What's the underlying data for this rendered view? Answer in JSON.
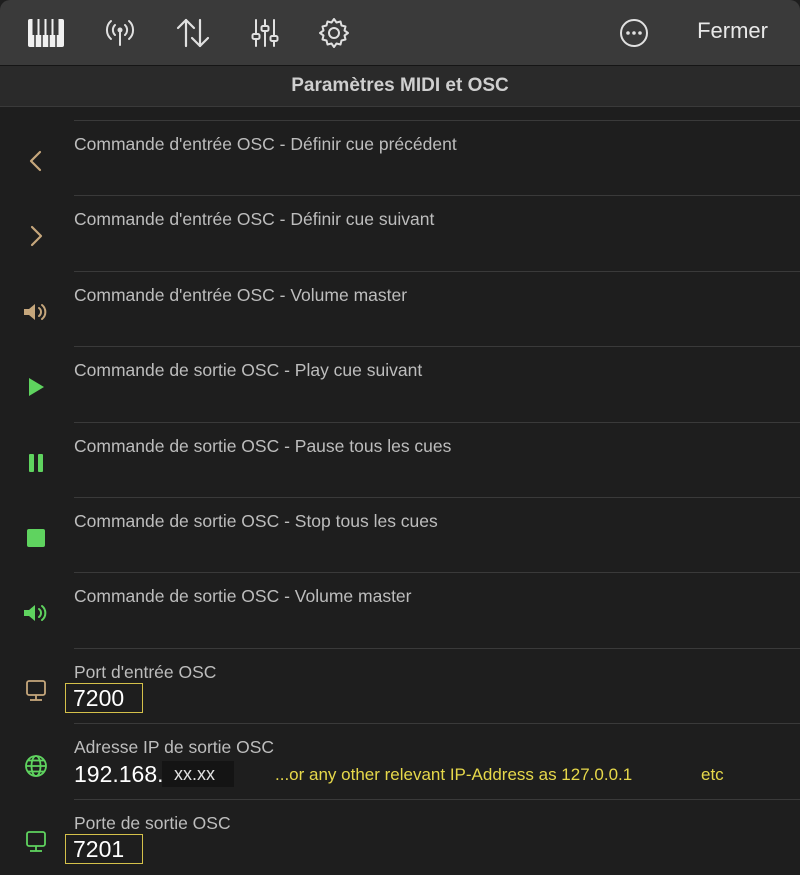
{
  "toolbar": {
    "icons": [
      "piano-keyboard-icon",
      "broadcast-antenna-icon",
      "up-down-arrows-icon",
      "sliders-icon",
      "gear-icon",
      "more-ellipsis-icon"
    ],
    "close_label": "Fermer"
  },
  "title": "Paramètres MIDI et OSC",
  "rows": [
    {
      "label": "Commande d'entrée OSC - Définir cue précédent",
      "icon": "chevron-left-icon"
    },
    {
      "label": "Commande d'entrée OSC - Définir cue suivant",
      "icon": "chevron-right-icon"
    },
    {
      "label": "Commande d'entrée OSC - Volume master",
      "icon": "speaker-icon"
    },
    {
      "label": "Commande de sortie OSC - Play cue suivant",
      "icon": "play-icon"
    },
    {
      "label": "Commande de sortie OSC - Pause tous les cues",
      "icon": "pause-icon"
    },
    {
      "label": "Commande de sortie OSC - Stop tous les cues",
      "icon": "stop-icon"
    },
    {
      "label": "Commande de sortie OSC - Volume master",
      "icon": "speaker-icon"
    }
  ],
  "input_port": {
    "label": "Port d'entrée OSC",
    "value": "7200",
    "icon": "computer-icon"
  },
  "output_ip": {
    "label": "Adresse IP de sortie OSC",
    "value_prefix": "192.168.",
    "masked": "xx.xx",
    "note": "...or any other relevant IP-Address as 127.0.0.1",
    "note_suffix": "etc",
    "icon": "globe-icon"
  },
  "output_port": {
    "label": "Porte de sortie OSC",
    "value": "7201",
    "icon": "computer-icon"
  },
  "colors": {
    "accent_tan": "#c6a77c",
    "accent_green": "#5fd35f",
    "highlight_yellow": "#d4c04a"
  }
}
